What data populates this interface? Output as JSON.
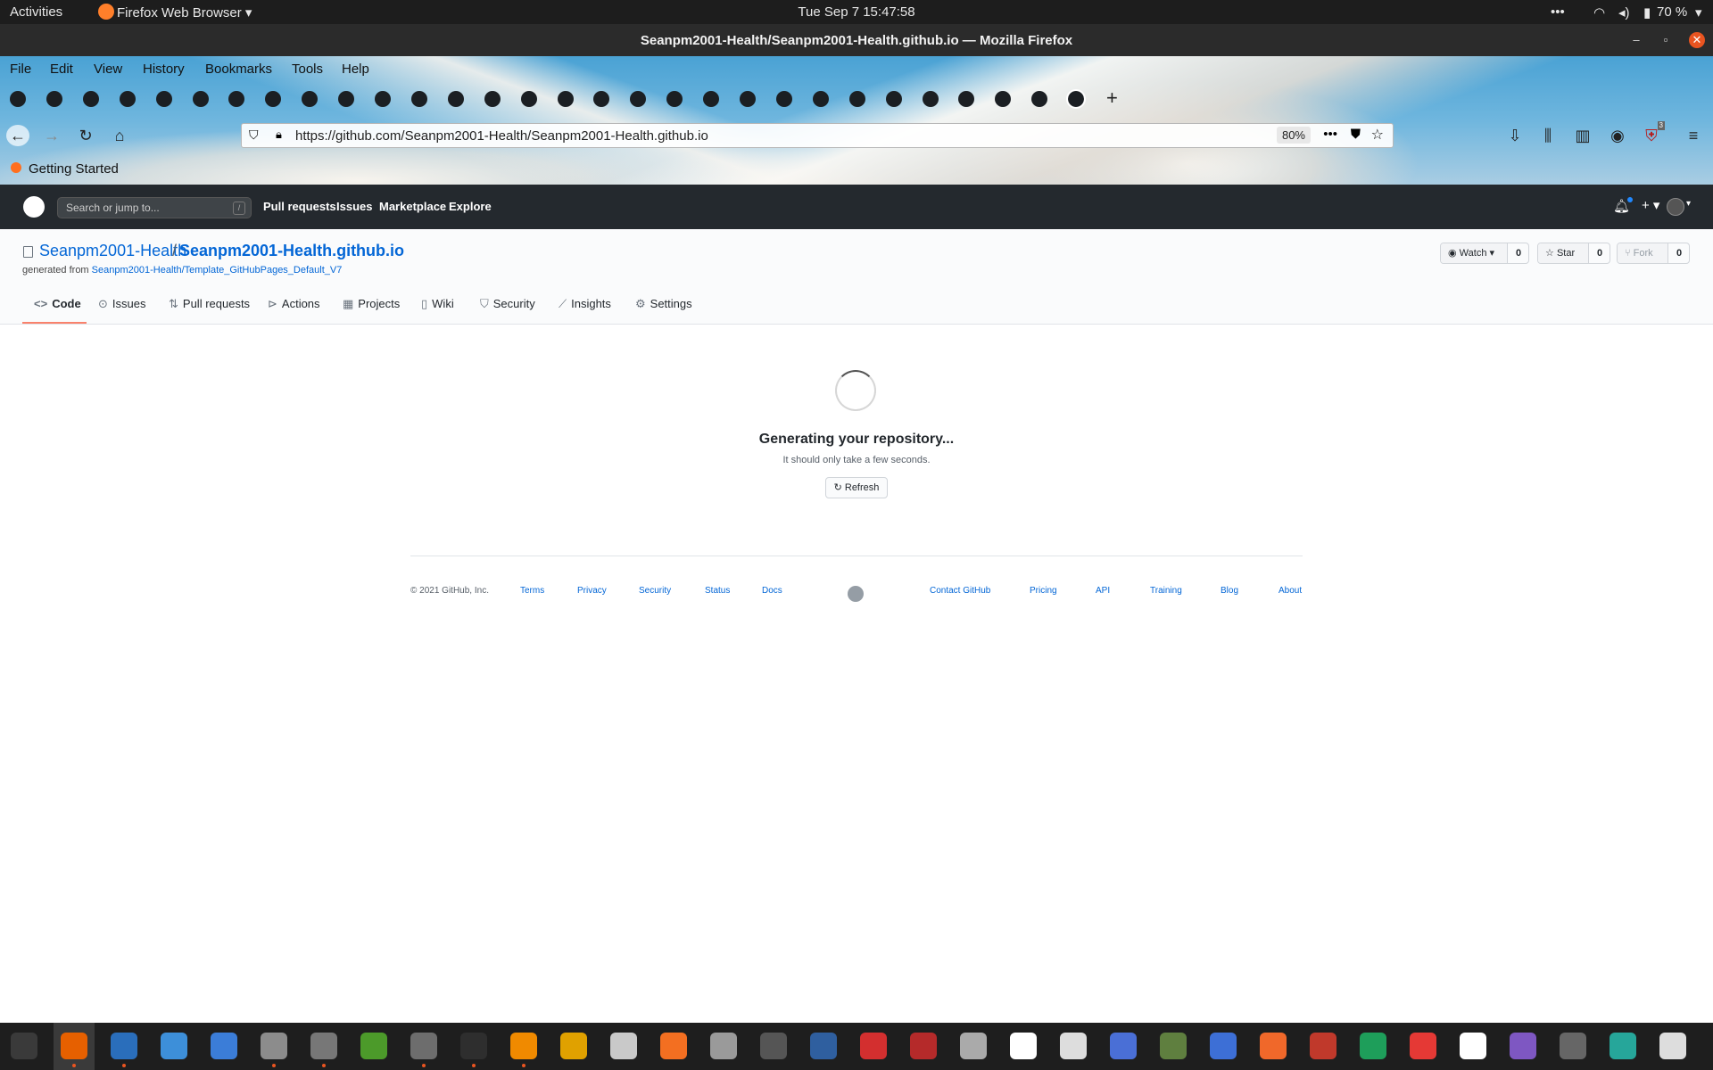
{
  "system": {
    "activities": "Activities",
    "app_menu": "Firefox Web Browser",
    "clock": "Tue Sep 7  15:47:58",
    "battery": "70 %"
  },
  "window": {
    "title": "Seanpm2001-Health/Seanpm2001-Health.github.io — Mozilla Firefox"
  },
  "firefox": {
    "menu": [
      "File",
      "Edit",
      "View",
      "History",
      "Bookmarks",
      "Tools",
      "Help"
    ],
    "url": "https://github.com/Seanpm2001-Health/Seanpm2001-Health.github.io",
    "zoom": "80%",
    "bookmark": "Getting Started",
    "ublock_badge": "3"
  },
  "github": {
    "search_placeholder": "Search or jump to...",
    "search_key": "/",
    "nav": [
      "Pull requests",
      "Issues",
      "Marketplace",
      "Explore"
    ],
    "repo_owner": "Seanpm2001-Health",
    "separator": "/",
    "repo_name": "Seanpm2001-Health.github.io",
    "generated_from_label": "generated from",
    "generated_from_link": "Seanpm2001-Health/Template_GitHubPages_Default_V7",
    "watch": {
      "label": "Watch",
      "count": "0"
    },
    "star": {
      "label": "Star",
      "count": "0"
    },
    "fork": {
      "label": "Fork",
      "count": "0"
    },
    "tabs": [
      "Code",
      "Issues",
      "Pull requests",
      "Actions",
      "Projects",
      "Wiki",
      "Security",
      "Insights",
      "Settings"
    ],
    "main": {
      "title": "Generating your repository...",
      "subtitle": "It should only take a few seconds.",
      "refresh": "Refresh"
    },
    "footer": {
      "copyright": "© 2021 GitHub, Inc.",
      "left_links": [
        "Terms",
        "Privacy",
        "Security",
        "Status",
        "Docs"
      ],
      "right_links": [
        "Contact GitHub",
        "Pricing",
        "API",
        "Training",
        "Blog",
        "About"
      ]
    }
  },
  "dock_colors": [
    "#3a3a3a",
    "#e66000",
    "#2a6ebb",
    "#3d8fd9",
    "#3b7dd8",
    "#8c8c8c",
    "#777777",
    "#4c9a2a",
    "#6d6d6d",
    "#2e2e2e",
    "#f08a00",
    "#e0a100",
    "#c9c9c9",
    "#f36f21",
    "#9a9a9a",
    "#555555",
    "#2f5f9f",
    "#d32f2f",
    "#b52a2a",
    "#aaaaaa",
    "#ffffff",
    "#dddddd",
    "#4a6fd6",
    "#5f7f3f",
    "#3d6fd6",
    "#f0682a",
    "#c0392b",
    "#1e9e5a",
    "#e53935",
    "#ffffff",
    "#7e57c2",
    "#666666",
    "#26a69a",
    "#dddddd"
  ]
}
